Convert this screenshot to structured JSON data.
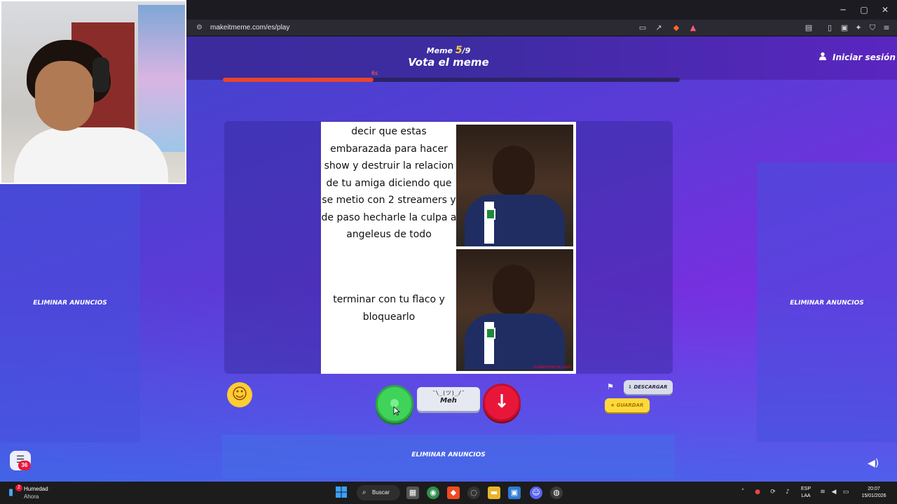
{
  "browser": {
    "url": "makeitmeme.com/es/play",
    "window_controls": [
      "─",
      "▢",
      "✕"
    ]
  },
  "header": {
    "round_prefix": "Meme",
    "round_current": "5",
    "round_total": "/9",
    "title": "Vota el meme",
    "login_label": "Iniciar sesión",
    "timer_label": "6s",
    "timer_fraction": 0.33
  },
  "ads": {
    "left_label": "ELIMINAR ANUNCIOS",
    "right_label": "ELIMINAR ANUNCIOS",
    "bottom_label": "ELIMINAR ANUNCIOS"
  },
  "meme": {
    "top_caption": "decir que estas embarazada para hacer show y destruir la relacion de tu amiga diciendo que se metio con 2 streamers y de paso hecharle la culpa a angeleus de todo",
    "bottom_caption": "terminar con tu flaco y bloquearlo",
    "watermark": "makeitmeme.com"
  },
  "vote": {
    "meh_shrug": "¯\\_(ツ)_/¯",
    "meh_label": "Meh",
    "down_glyph": "↓",
    "emoji": "☺"
  },
  "actions": {
    "download_label": "DESCARGAR",
    "save_label": "GUARDAR"
  },
  "chat": {
    "count": "36"
  },
  "taskbar": {
    "weather_title": "Humedad",
    "weather_sub": "Ahora",
    "weather_badge": "2",
    "search_label": "Buscar",
    "lang_top": "ESP",
    "lang_bottom": "LAA",
    "time": "20:07",
    "date": "15/01/2026"
  },
  "colors": {
    "vote_up": "#3fd35a",
    "vote_down": "#e8173a",
    "timer": "#e8452c",
    "round_accent": "#ffd23a",
    "save": "#ffd83a"
  }
}
